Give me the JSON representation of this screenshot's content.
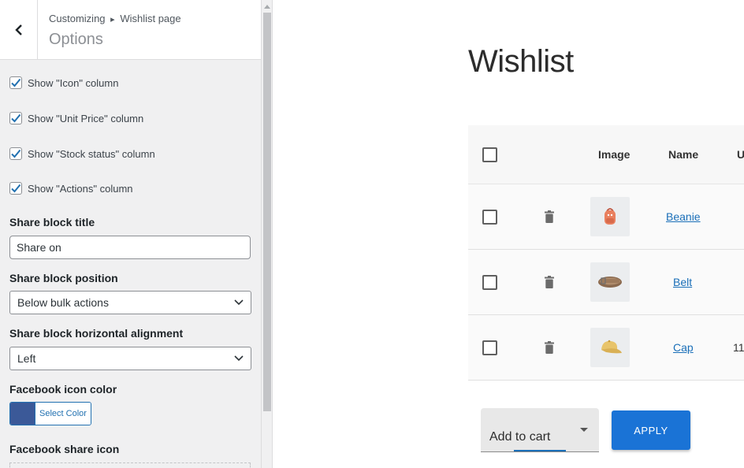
{
  "sidebar": {
    "breadcrumb": {
      "root": "Customizing",
      "separator": "▸",
      "current": "Wishlist page"
    },
    "title": "Options",
    "checkboxes": [
      {
        "label": "Show \"Icon\" column",
        "checked": true
      },
      {
        "label": "Show \"Unit Price\" column",
        "checked": true
      },
      {
        "label": "Show \"Stock status\" column",
        "checked": true
      },
      {
        "label": "Show \"Actions\" column",
        "checked": true
      }
    ],
    "share_title": {
      "label": "Share block title",
      "value": "Share on"
    },
    "share_position": {
      "label": "Share block position",
      "value": "Below bulk actions"
    },
    "share_alignment": {
      "label": "Share block horizontal alignment",
      "value": "Left"
    },
    "facebook_color": {
      "label": "Facebook icon color",
      "button": "Select Color",
      "color": "#3b5998"
    },
    "facebook_icon": {
      "label": "Facebook share icon"
    }
  },
  "preview": {
    "title": "Wishlist",
    "columns": {
      "image": "Image",
      "name": "Name",
      "price_partial": "U"
    },
    "rows": [
      {
        "name": "Beanie",
        "image_icon": "backpack-icon",
        "price": ""
      },
      {
        "name": "Belt",
        "image_icon": "belt-icon",
        "price": ""
      },
      {
        "name": "Cap",
        "image_icon": "cap-icon",
        "price": "11"
      }
    ],
    "bulk_action": "Add to cart",
    "apply_label": "APPLY"
  },
  "colors": {
    "accent": "#2271b1",
    "apply_button": "#1a73d6",
    "link": "#1a6fb8",
    "facebook": "#3b5998"
  }
}
